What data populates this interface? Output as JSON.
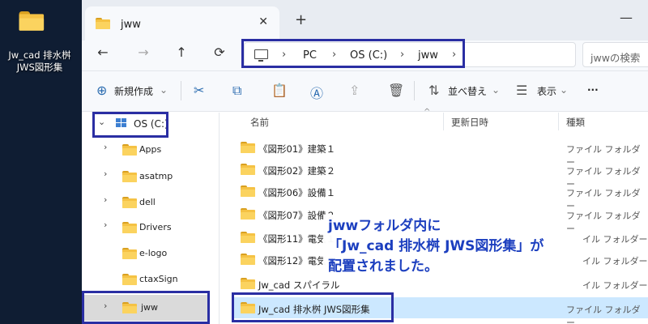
{
  "desktop": {
    "icon_label": "Jw_cad 排水桝\nJWS図形集",
    "icon_label_1": "Jw_cad 排水桝",
    "icon_label_2": "JWS図形集",
    "icon": "folder-icon"
  },
  "window": {
    "tab_title": "jww",
    "tab_close": "✕",
    "new_tab": "+",
    "minimize": "—"
  },
  "nav": {
    "back": "←",
    "forward": "→",
    "up": "↑",
    "refresh": "⟳",
    "breadcrumb": [
      "PC",
      "OS (C:)",
      "jww"
    ],
    "sep": "›",
    "more": "›",
    "search_placeholder": "jwwの検索"
  },
  "toolbar": {
    "new_label": "新規作成",
    "sort_label": "並べ替え",
    "view_label": "表示",
    "more_label": "···"
  },
  "navpane": {
    "drive_label": "OS (C:)",
    "items": [
      "Apps",
      "asatmp",
      "dell",
      "Drivers",
      "e-logo",
      "ctaxSign",
      "jww"
    ]
  },
  "filelist": {
    "headers": {
      "name": "名前",
      "date": "更新日時",
      "type": "種類"
    },
    "rows": [
      {
        "name": "《図形01》建築１",
        "type": "ファイル フォルダー"
      },
      {
        "name": "《図形02》建築２",
        "type": "ファイル フォルダー"
      },
      {
        "name": "《図形06》設備１",
        "type": "ファイル フォルダー"
      },
      {
        "name": "《図形07》設備２",
        "type": "ファイル フォルダー"
      },
      {
        "name": "《図形11》電気１",
        "type": "イル フォルダー"
      },
      {
        "name": "《図形12》電気２",
        "type": "イル フォルダー"
      },
      {
        "name": "Jw_cad スパイラル",
        "type": "イル フォルダー"
      },
      {
        "name": "Jw_cad 排水桝 JWS図形集",
        "type": "ファイル フォルダー"
      }
    ]
  },
  "annotation": {
    "line1": "jwwフォルダ内に",
    "line2": "「Jw_cad 排水桝 JWS図形集」が",
    "line3": "配置されました。",
    "color": "#1c3fbf",
    "box_color": "#2a2ea3"
  }
}
